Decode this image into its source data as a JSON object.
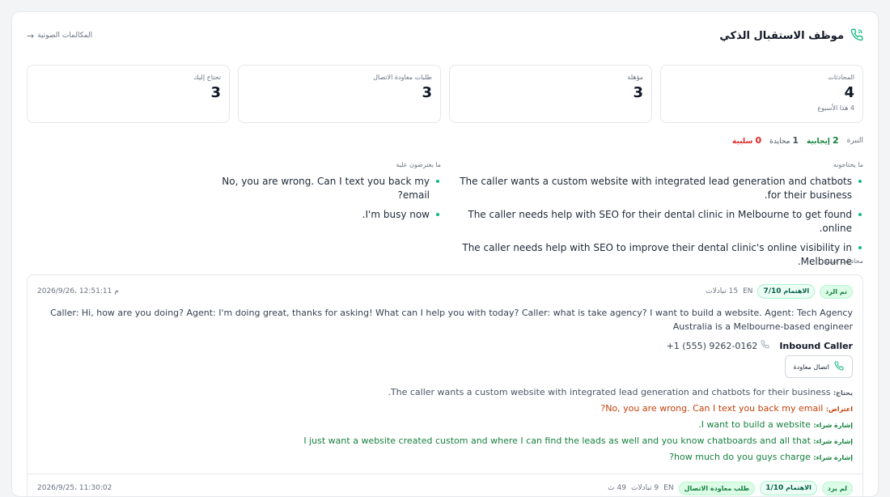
{
  "header": {
    "title": "موظف الاستقبال الذكي",
    "back_link": "المكالمات الصوتية"
  },
  "stats": [
    {
      "label": "المحادثات",
      "value": "4",
      "sub": "4 هذا الأسبوع"
    },
    {
      "label": "مؤهلة",
      "value": "3",
      "sub": ""
    },
    {
      "label": "طلبات معاودة الاتصال",
      "value": "3",
      "sub": ""
    },
    {
      "label": "تحتاج إليك",
      "value": "3",
      "sub": ""
    }
  ],
  "tone": {
    "label": "النبرة",
    "positive_count": "2",
    "positive_label": "إيجابية",
    "neutral_count": "1",
    "neutral_label": "محايدة",
    "negative_count": "0",
    "negative_label": "سلبية"
  },
  "needs": {
    "label": "ما يحتاجونه",
    "items": [
      "The caller wants a custom website with integrated lead generation and chatbots for their business.",
      "The caller needs help with SEO for their dental clinic in Melbourne to get found online.",
      "The caller needs help with SEO to improve their dental clinic's online visibility in Melbourne."
    ]
  },
  "objections": {
    "label": "ما يعترضون عليه",
    "items": [
      "No, you are wrong. Can I text you back my email?",
      "I'm busy now."
    ]
  },
  "recent": {
    "label": "محادثات حديثة",
    "call1": {
      "status": "تم الرد",
      "score_label": "الاهتمام",
      "score": "7/10",
      "lang": "EN",
      "exchanges": "15 تبادلات",
      "date": "2026/9/26، 12:51:11 م",
      "transcript": "Caller: Hi, how are you doing? Agent: I'm doing great, thanks for asking! What can I help you with today? Caller: what is take agency? I want to build a website. Agent: Tech Agency Australia is a Melbourne-based engineer",
      "caller_name": "Inbound Caller",
      "caller_phone": "+1 (555) 9262-0162",
      "callback_button": "اتصال معاودة",
      "need_key": "يحتاج:",
      "need_val": "The caller wants a custom website with integrated lead generation and chatbots for their business.",
      "obj_key": "اعتراض:",
      "obj_val": "No, you are wrong. Can I text you back my email?",
      "buy_key": "إشارة شراء:",
      "buy_vals": [
        "I want to build a website.",
        "I just want a website created custom and where I can find the leads as well and you know chatboards and all that",
        "how much do you guys charge?"
      ]
    },
    "call2": {
      "status": "لم يرد",
      "badge2": "طلب معاودة الاتصال",
      "score_label": "الاهتمام",
      "score": "1/10",
      "lang": "EN",
      "exchanges": "9 تبادلات",
      "duration": "49 ث",
      "date": "2026/9/25، 11:30:02"
    }
  }
}
